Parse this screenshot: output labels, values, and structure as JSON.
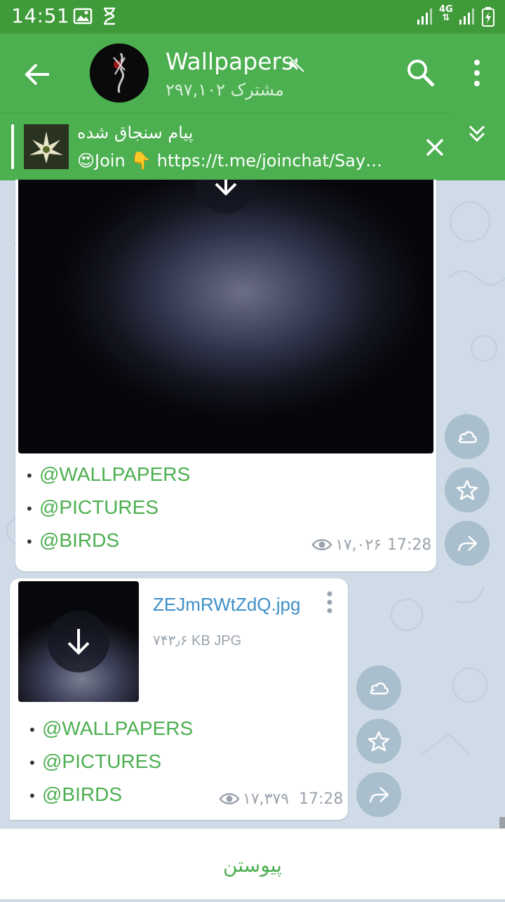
{
  "status_bar": {
    "time": "14:51",
    "icons": [
      "image-icon",
      "hourglass-icon",
      "signal-icon",
      "4g-icon",
      "signal-icon-2",
      "battery-charging-icon"
    ],
    "network_label": "4G"
  },
  "header": {
    "title": "Wallpapers",
    "subtitle": "۲۹۷,۱۰۲ مشترک",
    "muted": true
  },
  "pinned": {
    "title": "پیام سنجاق شده",
    "text": "😍Join 👇 https://t.me/joinchat/Say…"
  },
  "messages": [
    {
      "type": "photo",
      "tags": [
        "@WALLPAPERS",
        "@PICTURES",
        "@BIRDS"
      ],
      "views": "۱۷,۰۲۶",
      "time": "17:28"
    },
    {
      "type": "file",
      "file_name": "ZEJmRWtZdQ.jpg",
      "file_info": "۷۴۳٫۶ KB JPG",
      "tags": [
        "@WALLPAPERS",
        "@PICTURES",
        "@BIRDS"
      ],
      "views": "۱۷,۳۷۹",
      "time": "17:28"
    }
  ],
  "bottom": {
    "join_label": "پیوستن"
  },
  "colors": {
    "accent": "#4caf50",
    "status_bar": "#3f9a3a",
    "link": "#3f8fc8",
    "chat_bg": "#cfdbe6"
  }
}
